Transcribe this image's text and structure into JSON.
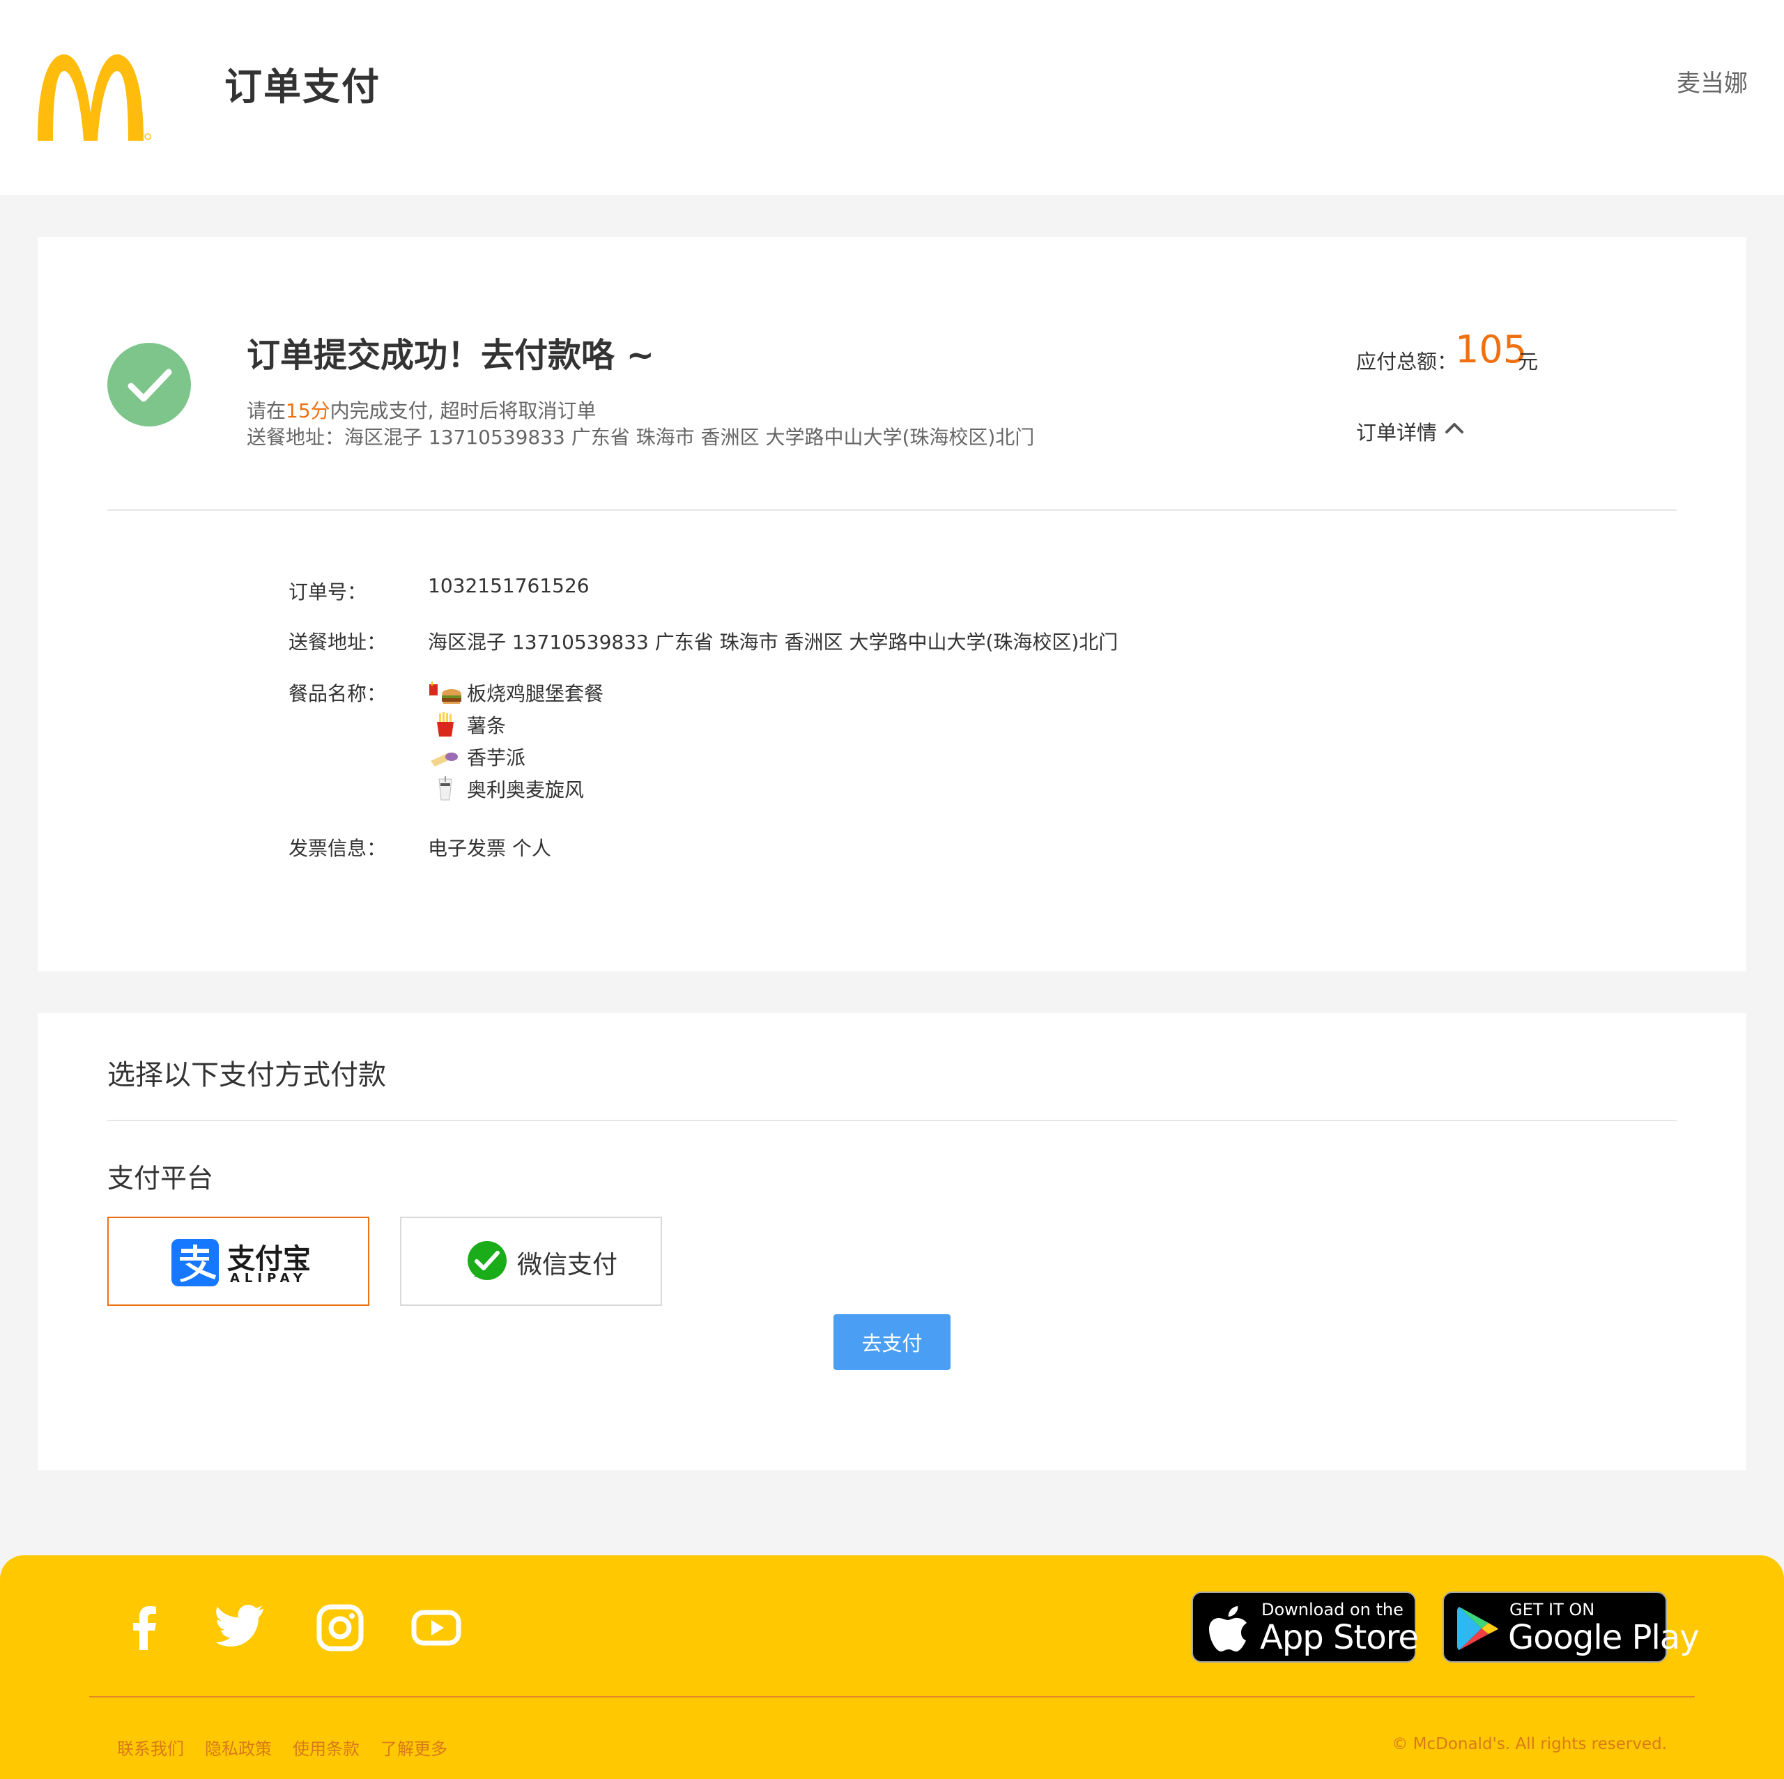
{
  "header": {
    "title": "订单支付",
    "user_name": "麦当娜",
    "logo_icon": "mcdonalds-golden-arches"
  },
  "order": {
    "success_title": "订单提交成功！去付款咯 ~",
    "countdown": {
      "prefix": "请在",
      "minutes": "15分",
      "suffix": "内完成支付, 超时后将取消订单"
    },
    "address_line": "送餐地址：海区混子 13710539833 广东省 珠海市 香洲区 大学路中山大学(珠海校区)北门",
    "total_label": "应付总额：",
    "total_amount": "105",
    "total_unit": "元",
    "detail_toggle": "订单详情",
    "details": {
      "order_no_label": "订单号：",
      "order_no": "1032151761526",
      "address_label": "送餐地址：",
      "address": "海区混子 13710539833 广东省 珠海市 香洲区 大学路中山大学(珠海校区)北门",
      "meals_label": "餐品名称：",
      "meals": [
        {
          "name": "板烧鸡腿堡套餐",
          "icon": "burger-meal-icon"
        },
        {
          "name": "薯条",
          "icon": "fries-icon"
        },
        {
          "name": "香芋派",
          "icon": "taro-pie-icon"
        },
        {
          "name": "奥利奥麦旋风",
          "icon": "mcflurry-icon"
        }
      ],
      "invoice_label": "发票信息：",
      "invoice": "电子发票 个人"
    }
  },
  "payment": {
    "title": "选择以下支付方式付款",
    "platform_label": "支付平台",
    "options": [
      {
        "name": "支付宝",
        "sub": "ALIPAY",
        "selected": true
      },
      {
        "name": "微信支付",
        "selected": false
      }
    ],
    "go_pay_label": "去支付"
  },
  "footer": {
    "social_icons": [
      "facebook-icon",
      "twitter-icon",
      "instagram-icon",
      "youtube-icon"
    ],
    "app_store": {
      "small": "Download on the",
      "big": "App Store"
    },
    "google_play": {
      "small": "GET IT ON",
      "big": "Google Play"
    },
    "links": [
      "联系我们",
      "隐私政策",
      "使用条款",
      "了解更多"
    ],
    "copyright": "© McDonald's. All rights reserved."
  },
  "colors": {
    "accent_orange": "#f07010",
    "footer_yellow": "#ffc800",
    "success_green": "#7dc58b",
    "button_blue": "#4a9ff5"
  }
}
